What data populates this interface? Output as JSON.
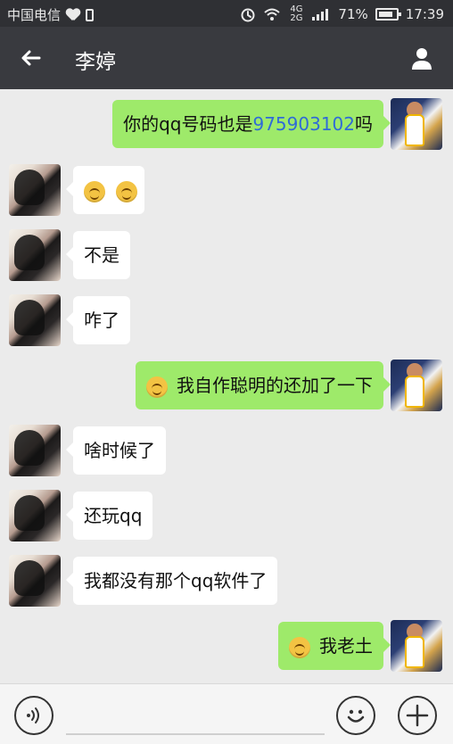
{
  "status_bar": {
    "carrier": "中国电信",
    "network": "4G 2G",
    "battery_percent": "71%",
    "time": "17:39"
  },
  "header": {
    "contact_name": "李婷"
  },
  "messages": [
    {
      "side": "right",
      "text_before": "你的qq号码也是",
      "number": "975903102",
      "text_after": "吗"
    },
    {
      "side": "left",
      "text": "",
      "emojis": [
        "smile",
        "smile"
      ]
    },
    {
      "side": "left",
      "text": "不是"
    },
    {
      "side": "left",
      "text": "咋了"
    },
    {
      "side": "right",
      "text": "我自作聪明的还加了一下",
      "emoji_prefix": "smirk"
    },
    {
      "side": "left",
      "text": "啥时候了"
    },
    {
      "side": "left",
      "text": "还玩qq"
    },
    {
      "side": "left",
      "text": "我都没有那个qq软件了"
    },
    {
      "side": "right",
      "text": "我老土",
      "emoji_prefix": "blush"
    }
  ],
  "bottom_bar": {
    "voice_icon": "voice-icon",
    "emoji_icon": "emoji-icon",
    "plus_icon": "plus-icon"
  },
  "colors": {
    "header_bg": "#393a3f",
    "status_bg": "#2f3034",
    "bubble_green": "#9eea6a",
    "bubble_white": "#ffffff",
    "chat_bg": "#ebebeb"
  }
}
